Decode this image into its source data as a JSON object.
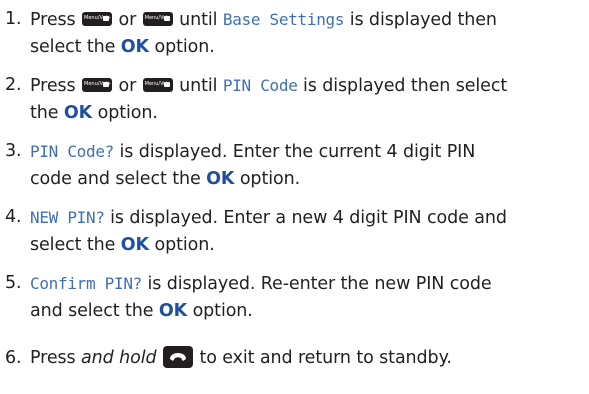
{
  "steps": [
    {
      "number": "1.",
      "parts": {
        "press": "Press",
        "key1": "Menu/Vol+",
        "or": "or",
        "key2": "Menu/Vol–",
        "until": "until",
        "lcd": "Base Settings",
        "after_lcd": "is displayed then",
        "line2": "select the",
        "ok": "OK",
        "end": "option."
      }
    },
    {
      "number": "2.",
      "parts": {
        "press": "Press",
        "key1": "Menu/Vol+",
        "or": "or",
        "key2": "Menu/Vol–",
        "until": "until",
        "lcd": "PIN Code",
        "after_lcd": "is displayed then select",
        "line2": "the",
        "ok": "OK",
        "end": "option."
      }
    },
    {
      "number": "3.",
      "parts": {
        "lcd": "PIN Code?",
        "after_lcd": "is displayed. Enter the current 4 digit PIN",
        "line2": "code and select the",
        "ok": "OK",
        "end": "option."
      }
    },
    {
      "number": "4.",
      "parts": {
        "lcd": "NEW PIN?",
        "after_lcd": "is displayed. Enter a new 4 digit PIN code and",
        "line2": "select the",
        "ok": "OK",
        "end": "option."
      }
    },
    {
      "number": "5.",
      "parts": {
        "lcd": "Confirm PIN?",
        "after_lcd": "is displayed. Re-enter the new PIN code",
        "line2": "and select the",
        "ok": "OK",
        "end": "option."
      }
    },
    {
      "number": "6.",
      "parts": {
        "press": "Press",
        "hold": "and hold",
        "end": "to exit and return to standby."
      }
    }
  ],
  "colors": {
    "text": "#231f20",
    "lcd_text": "#3e6fb6",
    "ok_text": "#1f4f9e",
    "key_fill": "#231f20"
  },
  "icons": {
    "menu_vol_up": "menu-vol-up-key-icon",
    "menu_vol_down": "menu-vol-down-key-icon",
    "end_call": "end-call-key-icon"
  }
}
